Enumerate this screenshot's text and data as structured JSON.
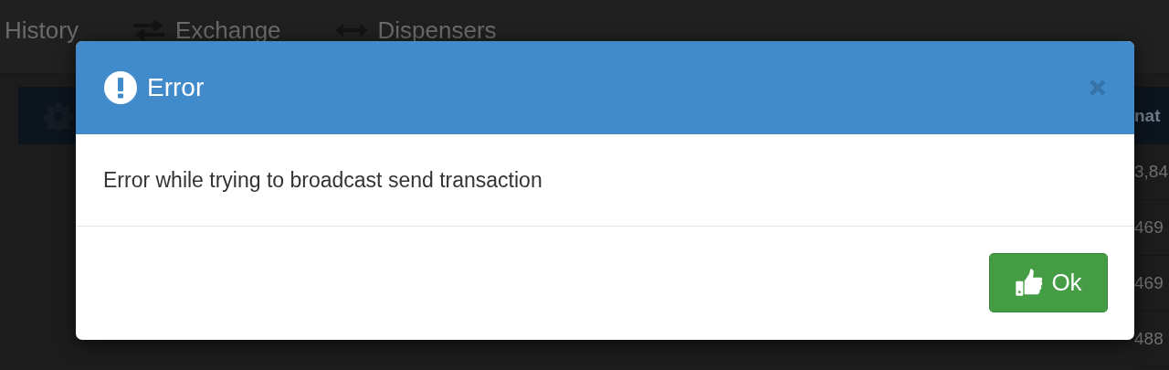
{
  "background": {
    "nav": [
      {
        "label": "History",
        "kind": "plain"
      },
      {
        "label": "Exchange",
        "kind": "exchange"
      },
      {
        "label": "Dispensers",
        "kind": "dispensers"
      }
    ],
    "table_header": "nat",
    "table_cells": [
      "3,84",
      "469",
      "469",
      "488"
    ]
  },
  "dialog": {
    "title": "Error",
    "message": "Error while trying to broadcast send transaction",
    "buttons": [
      {
        "label": "Ok",
        "kind": "confirm"
      }
    ]
  }
}
